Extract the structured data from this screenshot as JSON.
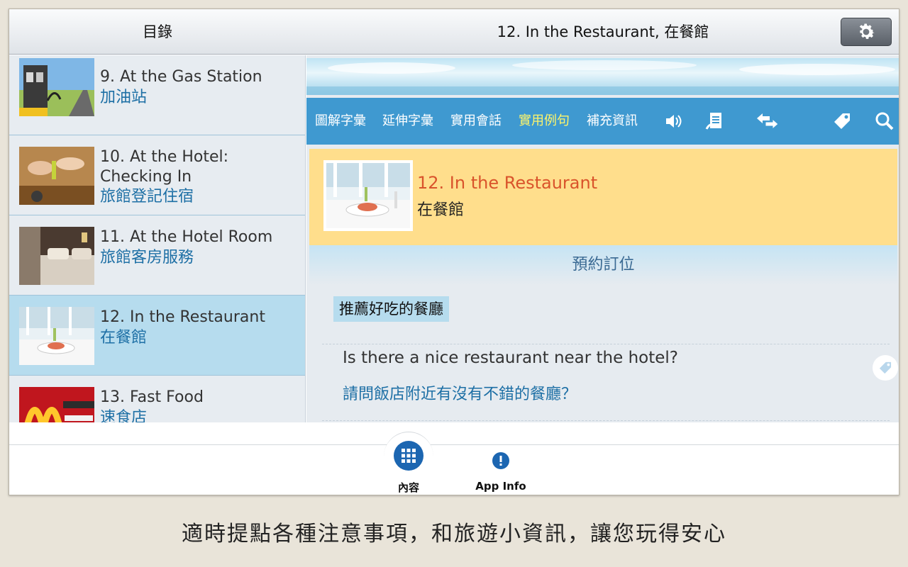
{
  "header": {
    "toc_title": "目錄",
    "lesson_title": "12. In the Restaurant, 在餐館",
    "settings_icon": "gear-icon"
  },
  "sidebar": {
    "items": [
      {
        "en": "9. At the Gas Station",
        "zh": "加油站",
        "image": "gas-station"
      },
      {
        "en": "10. At the Hotel: Checking In",
        "zh": "旅館登記住宿",
        "image": "hotel-key"
      },
      {
        "en": "11. At the Hotel Room",
        "zh": "旅館客房服務",
        "image": "hotel-room"
      },
      {
        "en": "12. In the Restaurant",
        "zh": "在餐館",
        "image": "restaurant",
        "selected": true
      },
      {
        "en": "13. Fast Food",
        "zh": "速食店",
        "image": "fast-food"
      }
    ]
  },
  "toolbar": {
    "tabs": [
      "圖解字彙",
      "延伸字彙",
      "實用會話",
      "實用例句",
      "補充資訊"
    ],
    "active_tab": "實用例句",
    "icons": [
      "speaker-icon",
      "transcript-icon",
      "swap-icon",
      "tag-icon",
      "search-icon"
    ]
  },
  "lesson": {
    "title_en": "12. In the Restaurant",
    "title_zh": "在餐館"
  },
  "section": {
    "title": "預約訂位",
    "sub_label": "推薦好吃的餐廳",
    "sentences": [
      {
        "en": "Is there a nice restaurant near the hotel?",
        "zh": "請問飯店附近有沒有不錯的餐廳？"
      }
    ]
  },
  "bottom_nav": {
    "contents_label": "內容",
    "info_label": "App Info"
  },
  "caption": "適時提點各種注意事項，和旅遊小資訊，讓您玩得安心",
  "colors": {
    "toolbar": "#3f99d0",
    "active_tab": "#fff56a",
    "lesson_card": "#ffde8c",
    "selected_item": "#b6dcee",
    "accent_blue": "#1d6fa5"
  }
}
